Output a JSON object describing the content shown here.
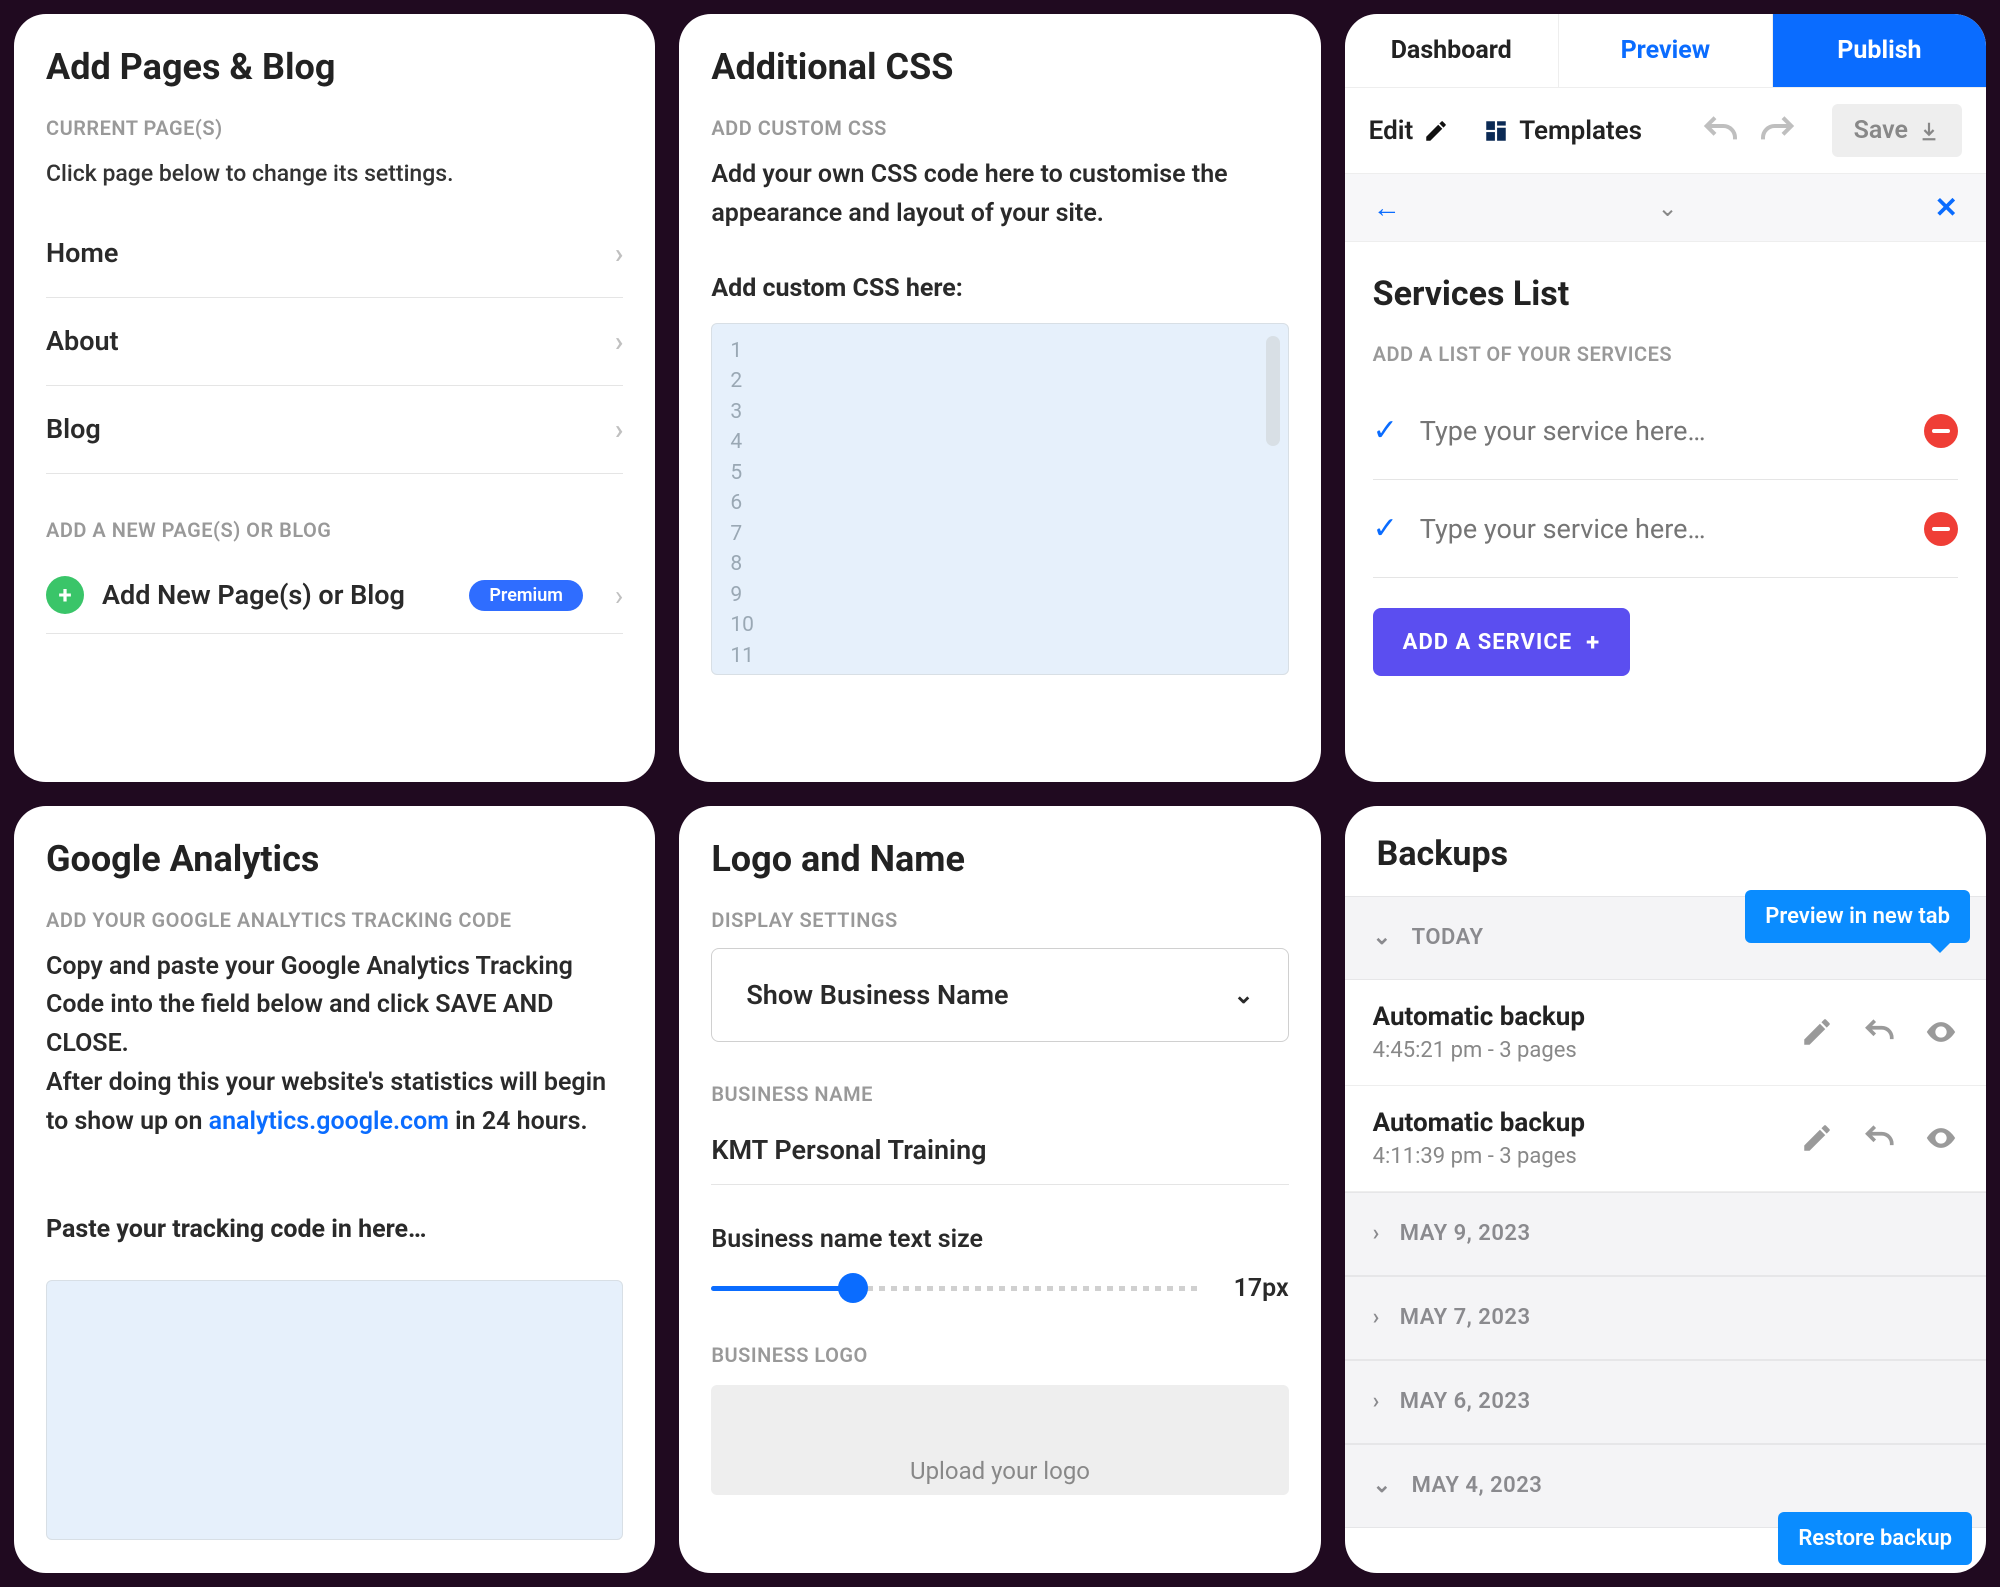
{
  "pages_panel": {
    "title": "Add Pages & Blog",
    "current_label": "CURRENT PAGE(S)",
    "current_desc": "Click page below to change its settings.",
    "pages": [
      "Home",
      "About",
      "Blog"
    ],
    "add_section_label": "ADD A NEW PAGE(S) OR BLOG",
    "add_label": "Add New Page(s) or Blog",
    "premium_badge": "Premium"
  },
  "css_panel": {
    "title": "Additional CSS",
    "sub": "ADD CUSTOM CSS",
    "desc": "Add your own CSS code here to customise the appearance and layout of your site.",
    "field_label": "Add custom CSS here:",
    "line_numbers": [
      "1",
      "2",
      "3",
      "4",
      "5",
      "6",
      "7",
      "8",
      "9",
      "10",
      "11"
    ]
  },
  "services_panel": {
    "tabs": {
      "dashboard": "Dashboard",
      "preview": "Preview",
      "publish": "Publish"
    },
    "toolbar": {
      "edit": "Edit",
      "templates": "Templates",
      "save": "Save"
    },
    "title": "Services List",
    "sub": "ADD A LIST OF YOUR SERVICES",
    "placeholder": "Type your service here…",
    "add_btn": "ADD A SERVICE"
  },
  "ga_panel": {
    "title": "Google Analytics",
    "sub": "ADD YOUR GOOGLE ANALYTICS TRACKING CODE",
    "desc_1": "Copy and paste your Google Analytics Tracking Code into the field below and click SAVE AND CLOSE.",
    "desc_2a": "After doing this your website's statistics will begin to show up on ",
    "link": "analytics.google.com",
    "desc_2b": " in 24 hours.",
    "field_label": "Paste your tracking code in here…"
  },
  "logo_panel": {
    "title": "Logo and Name",
    "display_sub": "DISPLAY SETTINGS",
    "select_value": "Show Business Name",
    "name_sub": "BUSINESS NAME",
    "name_value": "KMT Personal Training",
    "size_label": "Business name text size",
    "size_value": "17px",
    "logo_sub": "BUSINESS LOGO",
    "upload_label": "Upload your logo"
  },
  "backups_panel": {
    "title": "Backups",
    "groups": [
      {
        "label": "TODAY",
        "open": true,
        "items": [
          {
            "title": "Automatic backup",
            "meta": "4:45:21 pm - 3 pages"
          },
          {
            "title": "Automatic backup",
            "meta": "4:11:39 pm - 3 pages"
          }
        ]
      },
      {
        "label": "MAY 9, 2023",
        "open": false
      },
      {
        "label": "MAY 7, 2023",
        "open": false
      },
      {
        "label": "MAY 6, 2023",
        "open": false
      },
      {
        "label": "MAY 4, 2023",
        "open": true
      }
    ],
    "tooltip_preview": "Preview in new tab",
    "tooltip_restore": "Restore backup"
  }
}
